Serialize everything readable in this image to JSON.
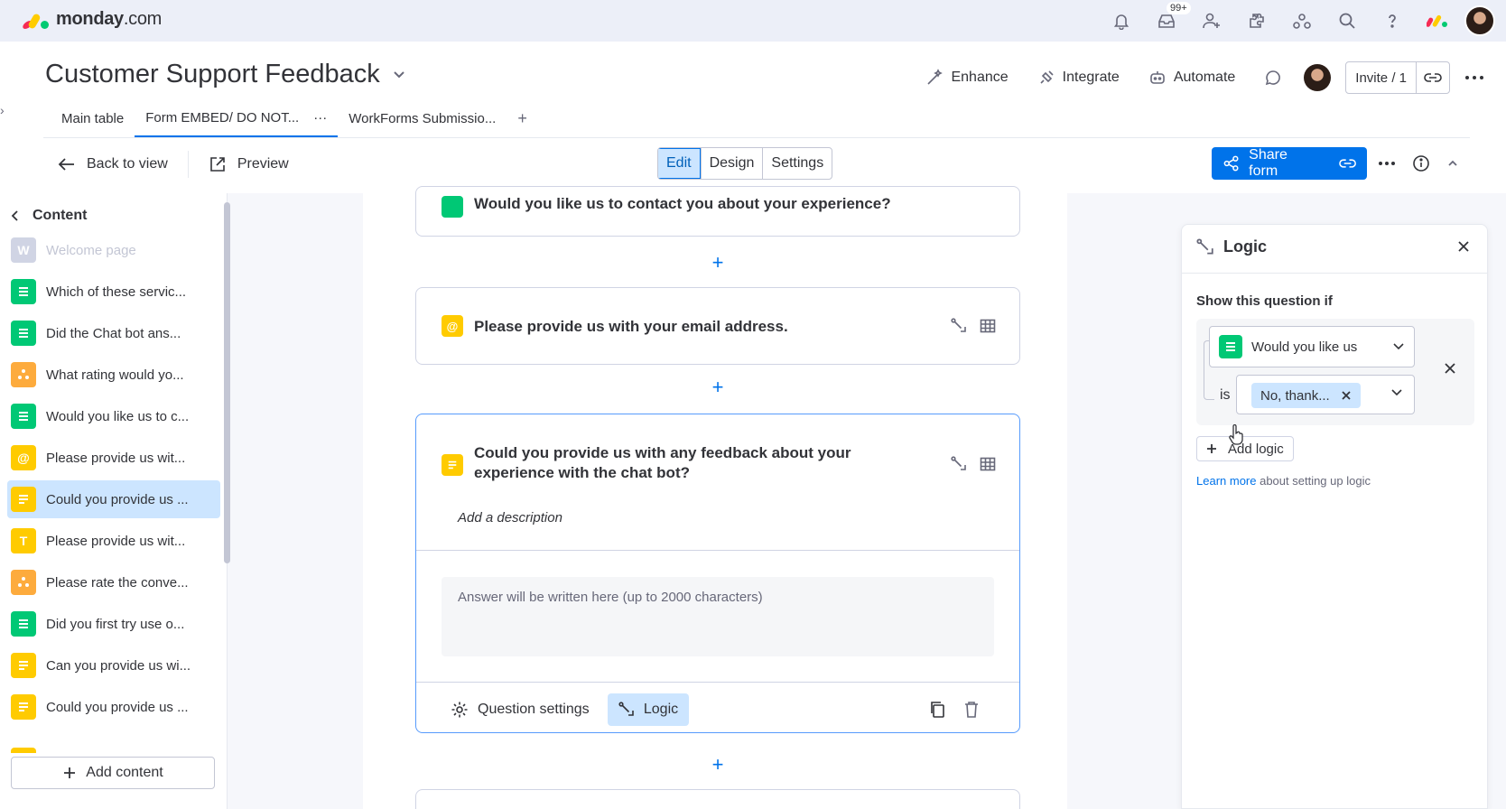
{
  "topbar": {
    "brand_bold": "monday",
    "brand_suffix": ".com",
    "notifications_badge": "99+",
    "icons": [
      "bell-icon",
      "inbox-icon",
      "invite-person-icon",
      "apps-icon",
      "integrations-icon",
      "search-icon",
      "help-icon",
      "monday-logo-icon",
      "user-avatar"
    ]
  },
  "board": {
    "title": "Customer Support Feedback",
    "actions": {
      "enhance": "Enhance",
      "integrate": "Integrate",
      "automate": "Automate",
      "invite": "Invite / 1"
    },
    "tabs": [
      {
        "label": "Main table"
      },
      {
        "label": "Form EMBED/ DO NOT...",
        "more": "···"
      },
      {
        "label": "WorkForms Submissio..."
      }
    ],
    "tab_add": "+"
  },
  "toolbar": {
    "back": "Back to view",
    "preview": "Preview",
    "modes": {
      "edit": "Edit",
      "design": "Design",
      "settings": "Settings"
    },
    "share": "Share form"
  },
  "sidebar": {
    "header": "Content",
    "items": [
      {
        "label": "Welcome page",
        "icon": "W",
        "color": "gray"
      },
      {
        "label": "Which of these servic...",
        "icon": "list",
        "color": "green"
      },
      {
        "label": "Did the Chat bot ans...",
        "icon": "list",
        "color": "green"
      },
      {
        "label": "What rating would yo...",
        "icon": "rating",
        "color": "orange"
      },
      {
        "label": "Would you like us to c...",
        "icon": "list",
        "color": "green"
      },
      {
        "label": "Please provide us wit...",
        "icon": "@",
        "color": "yellow"
      },
      {
        "label": "Could you provide us ...",
        "icon": "long-text",
        "color": "yellow"
      },
      {
        "label": "Please provide us wit...",
        "icon": "T",
        "color": "yellow"
      },
      {
        "label": "Please rate the conve...",
        "icon": "rating",
        "color": "orange"
      },
      {
        "label": "Did you first try use o...",
        "icon": "list",
        "color": "green"
      },
      {
        "label": "Can you provide us wi...",
        "icon": "long-text",
        "color": "yellow"
      },
      {
        "label": "Could you provide us ...",
        "icon": "long-text",
        "color": "yellow"
      }
    ],
    "add_content": "Add content"
  },
  "form": {
    "prev_question_partial": "Would you like us to contact you about your experience?",
    "email_question": "Please provide us with your email address.",
    "active_question": {
      "title_line1": "Could you provide us with any feedback about your",
      "title_line2": "experience with the chat bot?",
      "description_placeholder": "Add a description",
      "answer_placeholder": "Answer will be written here (up to 2000 characters)",
      "question_settings": "Question settings",
      "logic": "Logic"
    }
  },
  "logic_panel": {
    "title": "Logic",
    "show_if": "Show this question if",
    "question_select": "Would you like us",
    "operator": "is",
    "value_chip": "No, thank...",
    "add_logic": "Add logic",
    "learn_more_link": "Learn more",
    "learn_more_rest": " about setting up logic"
  },
  "colors": {
    "primary": "#0073ea",
    "selected_bg": "#cce5ff",
    "green": "#00c875",
    "orange": "#fdab3d",
    "yellow": "#ffcb00"
  }
}
